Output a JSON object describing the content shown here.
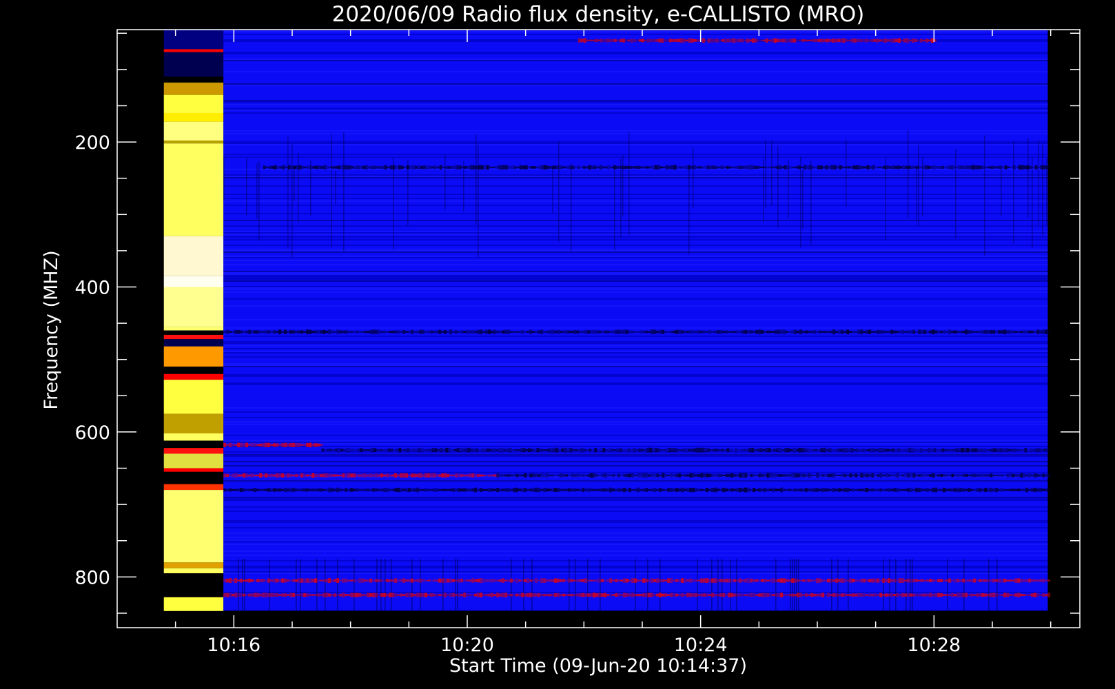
{
  "chart_data": {
    "type": "heatmap",
    "title": "2020/06/09  Radio flux density, e-CALLISTO (MRO)",
    "xlabel": "Start Time (09-Jun-20 10:14:37)",
    "ylabel": "Frequency (MHZ)",
    "x_ticks": [
      "10:16",
      "10:20",
      "10:24",
      "10:28"
    ],
    "x_tick_minutes": [
      16,
      20,
      24,
      28
    ],
    "x_range_minutes": [
      14.0,
      30.5
    ],
    "y_ticks": [
      200,
      400,
      600,
      800
    ],
    "y_range": [
      45,
      870
    ],
    "y_inverted": true,
    "data_x_range_minutes": [
      14.8,
      29.95
    ],
    "data_y_range": [
      45,
      847
    ],
    "calibration_minutes": [
      14.8,
      15.82
    ],
    "colormap": [
      "#000000",
      "#0000ff",
      "#ff0000",
      "#ff9900",
      "#ffff00",
      "#ffffff"
    ],
    "background_level": "blue",
    "features": [
      {
        "kind": "band",
        "freq": 462,
        "t0": 15.82,
        "t1": 29.95,
        "level": "dark"
      },
      {
        "kind": "band",
        "freq": 618,
        "t0": 15.82,
        "t1": 17.5,
        "level": "red"
      },
      {
        "kind": "band",
        "freq": 625,
        "t0": 17.5,
        "t1": 29.95,
        "level": "dark"
      },
      {
        "kind": "band",
        "freq": 660,
        "t0": 15.82,
        "t1": 20.5,
        "level": "red"
      },
      {
        "kind": "band",
        "freq": 660,
        "t0": 20.5,
        "t1": 29.95,
        "level": "dark"
      },
      {
        "kind": "band",
        "freq": 680,
        "t0": 15.82,
        "t1": 29.95,
        "level": "dark"
      },
      {
        "kind": "band",
        "freq": 805,
        "t0": 15.82,
        "t1": 29.95,
        "level": "red"
      },
      {
        "kind": "band",
        "freq": 825,
        "t0": 15.82,
        "t1": 29.95,
        "level": "red"
      },
      {
        "kind": "band",
        "freq": 60,
        "t0": 21.9,
        "t1": 28.0,
        "level": "red"
      },
      {
        "kind": "band",
        "freq": 235,
        "t0": 16.5,
        "t1": 29.95,
        "level": "dark"
      }
    ]
  }
}
